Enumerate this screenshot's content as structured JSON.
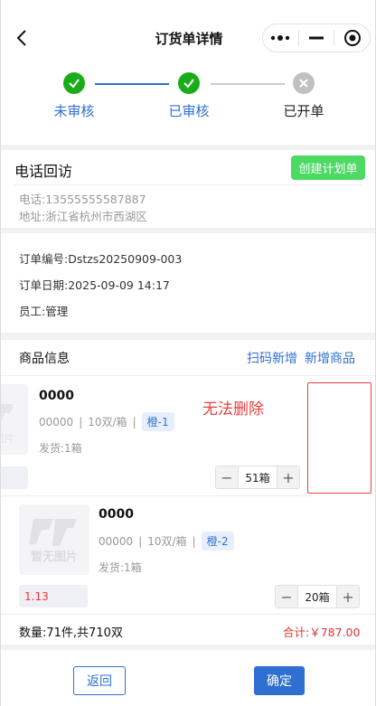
{
  "nav": {
    "title": "订货单详情"
  },
  "steps": [
    {
      "label": "未审核",
      "status": "done",
      "color": "#2f6fd2"
    },
    {
      "label": "已审核",
      "status": "done",
      "color": "#2f6fd2"
    },
    {
      "label": "已开单",
      "status": "inactive",
      "color": "#222222"
    }
  ],
  "callback": {
    "title": "电话回访",
    "create_plan_label": "创建计划单",
    "phone": "电话:13555555587887",
    "address": "地址:浙江省杭州市西湖区"
  },
  "order": {
    "number": "订单编号:Dstzs20250909-003",
    "date": "订单日期:2025-09-09 14:17",
    "staff": "员工:管理"
  },
  "products": {
    "title": "商品信息",
    "scan_add_label": "扫码新增",
    "add_product_label": "新增商品",
    "placeholder_text": "暂无图片",
    "items": [
      {
        "name": "0000",
        "code": "00000",
        "pack": "10双/箱",
        "tag": "橙-1",
        "shipped": "发货:1箱",
        "price": "",
        "qty": "51箱"
      },
      {
        "name": "0000",
        "code": "00000",
        "pack": "10双/箱",
        "tag": "橙-2",
        "shipped": "发货:1箱",
        "price": "1.13",
        "qty": "20箱"
      }
    ]
  },
  "annotation": {
    "text": "无法删除"
  },
  "summary": {
    "count": "数量:71件,共710双",
    "total": "合计:￥787.00"
  },
  "footer": {
    "back_label": "返回",
    "confirm_label": "确定"
  },
  "colors": {
    "accent": "#2f6fd2",
    "success": "#1aad19",
    "green_button": "#4cd964",
    "price_red": "#e33333"
  }
}
